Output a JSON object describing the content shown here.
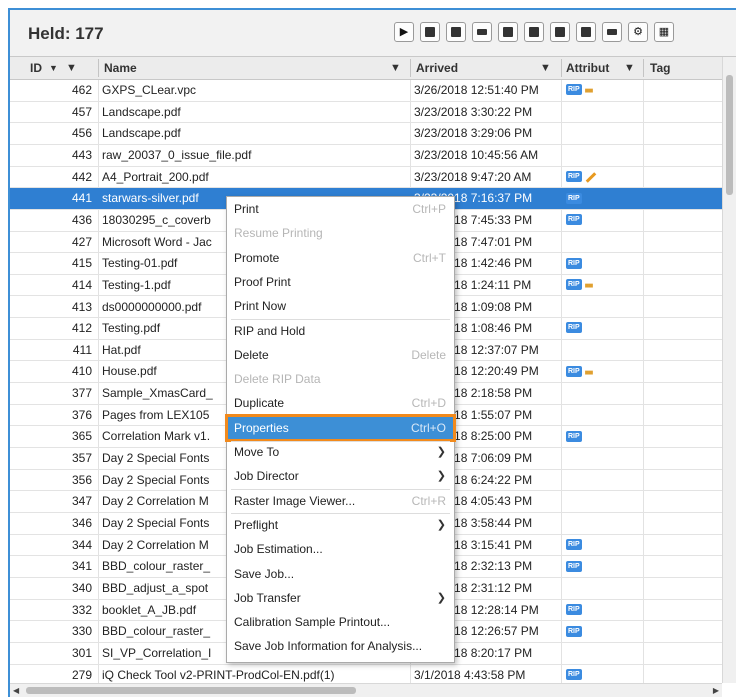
{
  "header": {
    "title": "Held: 177",
    "toolbar": [
      {
        "icon": "play-icon",
        "glyph": "▶"
      },
      {
        "icon": "document-view-icon"
      },
      {
        "icon": "document-edit-icon"
      },
      {
        "icon": "rip-icon",
        "style": "tag"
      },
      {
        "icon": "trash-icon"
      },
      {
        "icon": "list-icon"
      },
      {
        "icon": "merge-icon"
      },
      {
        "icon": "raster-icon"
      },
      {
        "icon": "printer-icon",
        "style": "tag"
      },
      {
        "icon": "gear-icon",
        "glyph": "⚙"
      },
      {
        "icon": "grid-icon",
        "glyph": "▦"
      }
    ]
  },
  "columns": {
    "id": "ID",
    "sort_indicator": "▼",
    "name": "Name",
    "arrived": "Arrived",
    "attributes": "Attribut",
    "tag": "Tag"
  },
  "rows": [
    {
      "id": "462",
      "name": "GXPS_CLear.vpc",
      "arrived": "3/26/2018 12:51:40 PM",
      "badge": "RIP",
      "extra": "dots"
    },
    {
      "id": "457",
      "name": "Landscape.pdf",
      "arrived": "3/23/2018 3:30:22 PM",
      "badge": "",
      "extra": ""
    },
    {
      "id": "456",
      "name": "Landscape.pdf",
      "arrived": "3/23/2018 3:29:06 PM",
      "badge": "",
      "extra": ""
    },
    {
      "id": "443",
      "name": "raw_20037_0_issue_file.pdf",
      "arrived": "3/23/2018 10:45:56 AM",
      "badge": "",
      "extra": ""
    },
    {
      "id": "442",
      "name": "A4_Portrait_200.pdf",
      "arrived": "3/23/2018 9:47:20 AM",
      "badge": "RIP",
      "extra": "pencil"
    },
    {
      "id": "441",
      "name": "starwars-silver.pdf",
      "arrived": "3/23/2018 7:16:37 PM",
      "badge": "RIP",
      "extra": "",
      "selected": true
    },
    {
      "id": "436",
      "name": "18030295_c_coverb",
      "arrived": "3/22/2018 7:45:33 PM",
      "badge": "RIP",
      "extra": ""
    },
    {
      "id": "427",
      "name": "Microsoft Word - Jac",
      "arrived": "3/22/2018 7:47:01 PM",
      "badge": "",
      "extra": ""
    },
    {
      "id": "415",
      "name": "Testing-01.pdf",
      "arrived": "3/21/2018 1:42:46 PM",
      "badge": "RIP",
      "extra": ""
    },
    {
      "id": "414",
      "name": "Testing-1.pdf",
      "arrived": "3/21/2018 1:24:11 PM",
      "badge": "RIP",
      "extra": "dots"
    },
    {
      "id": "413",
      "name": "ds0000000000.pdf",
      "arrived": "3/21/2018 1:09:08 PM",
      "badge": "",
      "extra": ""
    },
    {
      "id": "412",
      "name": "Testing.pdf",
      "arrived": "3/21/2018 1:08:46 PM",
      "badge": "RIP",
      "extra": ""
    },
    {
      "id": "411",
      "name": "Hat.pdf",
      "arrived": "3/21/2018 12:37:07 PM",
      "badge": "",
      "extra": ""
    },
    {
      "id": "410",
      "name": "House.pdf",
      "arrived": "3/21/2018 12:20:49 PM",
      "badge": "RIP",
      "extra": "dots"
    },
    {
      "id": "377",
      "name": "Sample_XmasCard_",
      "arrived": "3/20/2018 2:18:58 PM",
      "badge": "",
      "extra": ""
    },
    {
      "id": "376",
      "name": "Pages from LEX105",
      "arrived": "3/20/2018 1:55:07 PM",
      "badge": "",
      "extra": ""
    },
    {
      "id": "365",
      "name": "Correlation Mark v1.",
      "arrived": "3/20/2018 8:25:00 PM",
      "badge": "RIP",
      "extra": ""
    },
    {
      "id": "357",
      "name": "Day 2 Special Fonts",
      "arrived": "3/19/2018 7:06:09 PM",
      "badge": "",
      "extra": ""
    },
    {
      "id": "356",
      "name": "Day 2 Special Fonts",
      "arrived": "3/19/2018 6:24:22 PM",
      "badge": "",
      "extra": ""
    },
    {
      "id": "347",
      "name": "Day 2 Correlation M",
      "arrived": "3/19/2018 4:05:43 PM",
      "badge": "",
      "extra": ""
    },
    {
      "id": "346",
      "name": "Day 2 Special Fonts",
      "arrived": "3/19/2018 3:58:44 PM",
      "badge": "",
      "extra": ""
    },
    {
      "id": "344",
      "name": "Day 2 Correlation M",
      "arrived": "3/19/2018 3:15:41 PM",
      "badge": "RIP",
      "extra": ""
    },
    {
      "id": "341",
      "name": "BBD_colour_raster_",
      "arrived": "3/18/2018 2:32:13 PM",
      "badge": "RIP",
      "extra": ""
    },
    {
      "id": "340",
      "name": "BBD_adjust_a_spot",
      "arrived": "3/18/2018 2:31:12 PM",
      "badge": "",
      "extra": ""
    },
    {
      "id": "332",
      "name": "booklet_A_JB.pdf",
      "arrived": "3/18/2018 12:28:14 PM",
      "badge": "RIP",
      "extra": ""
    },
    {
      "id": "330",
      "name": "BBD_colour_raster_",
      "arrived": "3/18/2018 12:26:57 PM",
      "badge": "RIP",
      "extra": ""
    },
    {
      "id": "301",
      "name": "SI_VP_Correlation_I",
      "arrived": "3/18/2018 8:20:17 PM",
      "badge": "",
      "extra": ""
    },
    {
      "id": "279",
      "name": "iQ Check Tool v2-PRINT-ProdCol-EN.pdf(1)",
      "arrived": "3/1/2018 4:43:58 PM",
      "badge": "RIP",
      "extra": ""
    }
  ],
  "context_menu": [
    {
      "label": "Print",
      "shortcut": "Ctrl+P"
    },
    {
      "label": "Resume Printing",
      "disabled": true
    },
    {
      "label": "Promote",
      "shortcut": "Ctrl+T"
    },
    {
      "label": "Proof Print"
    },
    {
      "label": "Print Now"
    },
    {
      "label": "RIP and Hold",
      "separator_before": true
    },
    {
      "label": "Delete",
      "shortcut": "Delete"
    },
    {
      "label": "Delete RIP Data",
      "disabled": true
    },
    {
      "label": "Duplicate",
      "shortcut": "Ctrl+D"
    },
    {
      "label": "Properties",
      "shortcut": "Ctrl+O",
      "highlight": true
    },
    {
      "label": "Move To",
      "submenu": true,
      "separator_before": true
    },
    {
      "label": "Job Director",
      "submenu": true
    },
    {
      "label": "Raster Image Viewer...",
      "shortcut": "Ctrl+R",
      "separator_before": true
    },
    {
      "label": "Preflight",
      "submenu": true,
      "separator_before": true
    },
    {
      "label": "Job Estimation..."
    },
    {
      "label": "Save Job..."
    },
    {
      "label": "Job Transfer",
      "submenu": true
    },
    {
      "label": "Calibration Sample Printout..."
    },
    {
      "label": "Save Job Information for Analysis..."
    }
  ],
  "colors": {
    "accent": "#3d8fd6",
    "selected_row": "#2f7fd2",
    "highlight_outline": "#f28a1c",
    "rip_badge": "#3b8be0"
  }
}
